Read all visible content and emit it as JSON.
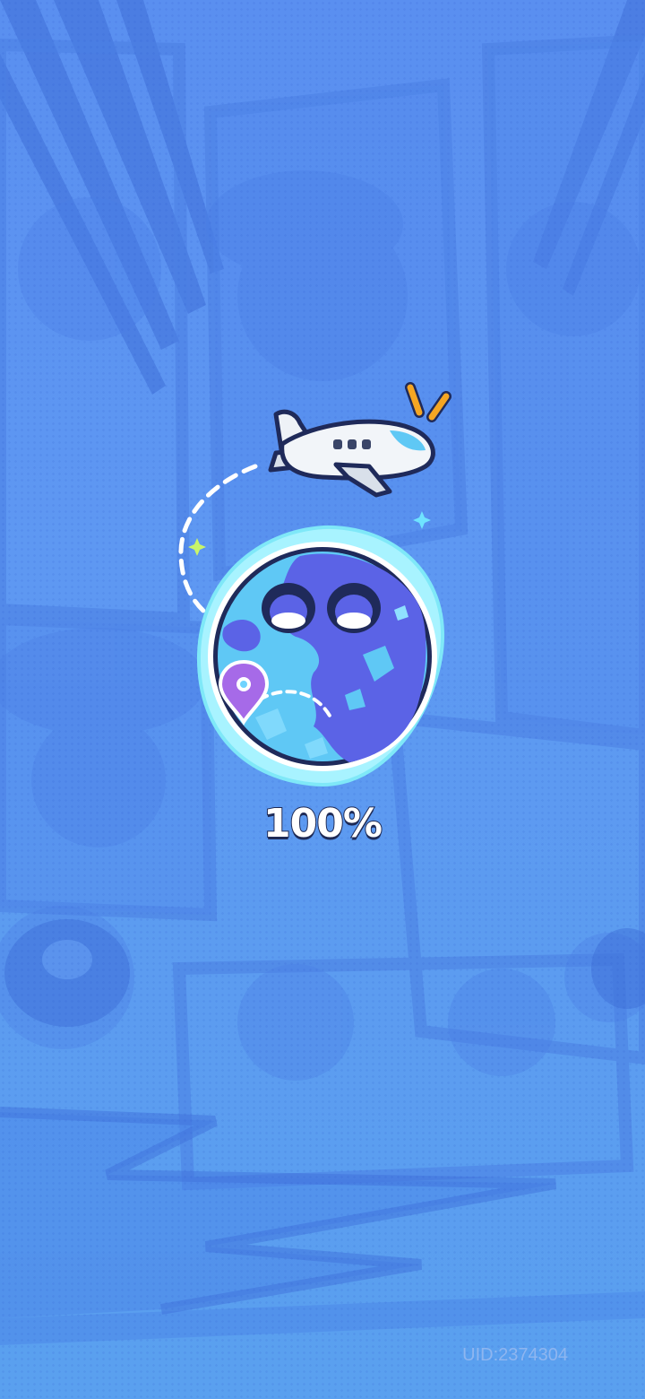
{
  "loading": {
    "progress_label": "100%",
    "progress": 1.0
  },
  "footer": {
    "uid": "UID:2374304"
  },
  "icons": {
    "globe": "globe-icon",
    "airplane": "airplane-icon",
    "location_pin": "location-pin-icon",
    "sparkle": "sparkle-icon"
  },
  "colors": {
    "background": "#5e98f2",
    "globe_ocean": "#5fc8f5",
    "globe_land": "#5b63e6",
    "globe_rim": "#e8fbff",
    "pin": "#a66ae8",
    "accent_orange": "#f5a623",
    "text_outline": "#1e2a55"
  }
}
